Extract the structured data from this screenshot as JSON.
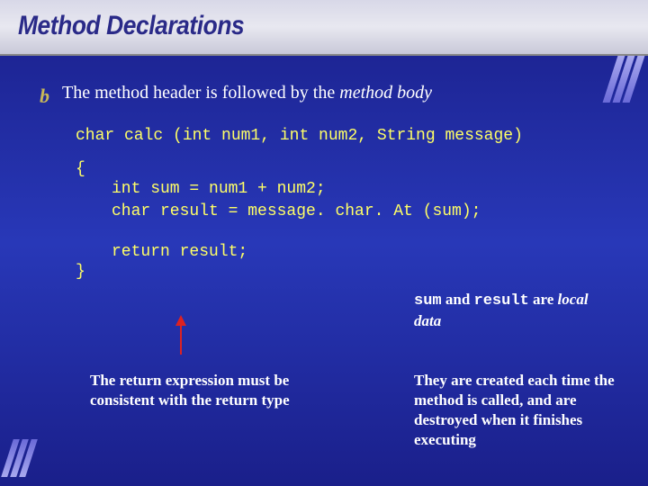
{
  "title": "Method Declarations",
  "bullet": {
    "prefix": "The method header is followed by the ",
    "emphasis": "method body"
  },
  "code": {
    "signature": "char calc (int num1, int num2, String message)",
    "brace_open": "{",
    "body_line1": "int sum = num1 + num2;",
    "body_line2": "char result = message. char. At (sum);",
    "return_line": "return result;",
    "brace_close": "}"
  },
  "annotations": {
    "right_top_part1": "sum",
    "right_top_part2": " and ",
    "right_top_part3": "result",
    "right_top_part4": " are ",
    "right_top_part5": "local data",
    "left_bottom": "The return expression must be consistent with the return type",
    "right_bottom": "They are created each time the method is called, and are destroyed when it finishes executing"
  }
}
